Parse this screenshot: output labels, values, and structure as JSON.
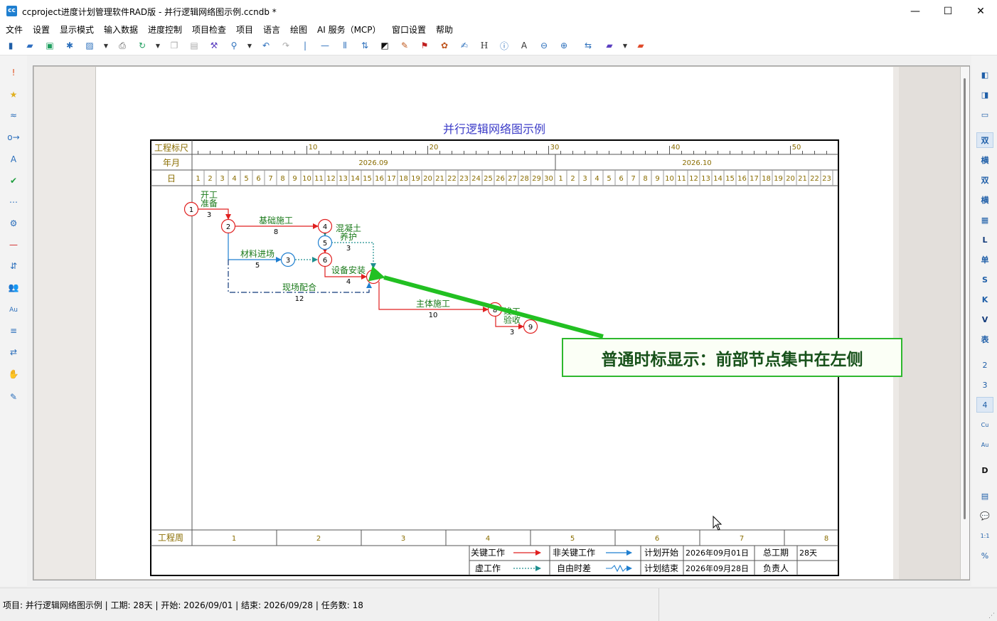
{
  "window": {
    "title": "ccproject进度计划管理软件RAD版 - 并行逻辑网络图示例.ccndb *",
    "minimize": "—",
    "maximize": "☐",
    "close": "✕"
  },
  "menu": [
    "文件",
    "设置",
    "显示模式",
    "输入数据",
    "进度控制",
    "项目检查",
    "项目",
    "语言",
    "绘图",
    "AI 服务（MCP）",
    "窗口设置",
    "帮助"
  ],
  "toolbar_icons": [
    "new",
    "open",
    "save",
    "asterisk",
    "image",
    "dropdown",
    "print",
    "refresh",
    "dropdown",
    "copy",
    "paste",
    "brush",
    "search",
    "dropdown",
    "undo",
    "redo",
    "vline",
    "hline",
    "bars",
    "sort",
    "blackbox",
    "paint",
    "flag",
    "palette",
    "edit",
    "H",
    "info",
    "A",
    "zoom-out",
    "zoom-in",
    "swap",
    "folder",
    "dropdown",
    "red-folder"
  ],
  "left_tools": [
    "!",
    "★",
    "≈",
    "o→",
    "A",
    "✔",
    "⋯",
    "⚙",
    "—",
    "⇵",
    "👥",
    "Au",
    "≡",
    "⇄",
    "✋",
    "✎"
  ],
  "right_tools": [
    "◧",
    "◨",
    "▭",
    "双",
    "横",
    "双",
    "横",
    "▦",
    "L",
    "单",
    "S",
    "K",
    "V",
    "表",
    "2",
    "3",
    "4",
    "Cu",
    "Au",
    "D",
    "▤",
    "💬",
    "1:1",
    "%"
  ],
  "diagram": {
    "title": "并行逻辑网络图示例",
    "header_labels": {
      "ruler": "工程标尺",
      "month": "年月",
      "day": "日",
      "week": "工程周"
    },
    "ruler_ticks": [
      "10",
      "20",
      "30",
      "40",
      "50"
    ],
    "months": [
      "2026.09",
      "2026.10"
    ],
    "days": [
      "1",
      "2",
      "3",
      "4",
      "5",
      "6",
      "7",
      "8",
      "9",
      "10",
      "11",
      "12",
      "13",
      "14",
      "15",
      "16",
      "17",
      "18",
      "19",
      "20",
      "21",
      "22",
      "23",
      "24",
      "25",
      "26",
      "27",
      "28",
      "29",
      "30",
      "1",
      "2",
      "3",
      "4",
      "5",
      "6",
      "7",
      "8",
      "9",
      "10",
      "11",
      "12",
      "13",
      "14",
      "15",
      "16",
      "17",
      "18",
      "19",
      "20",
      "21",
      "22",
      "23"
    ],
    "weeks": [
      "1",
      "2",
      "3",
      "4",
      "5",
      "6",
      "7",
      "8"
    ],
    "tasks": [
      {
        "name": "开工\n准备",
        "duration": "3",
        "type": "critical"
      },
      {
        "name": "基础施工",
        "duration": "8",
        "type": "critical"
      },
      {
        "name": "材料进场",
        "duration": "5",
        "type": "normal"
      },
      {
        "name": "混凝土\n养护",
        "duration": "3",
        "type": "dummy"
      },
      {
        "name": "设备安装",
        "duration": "4",
        "type": "critical"
      },
      {
        "name": "现场配合",
        "duration": "12",
        "type": "dummy"
      },
      {
        "name": "主体施工",
        "duration": "10",
        "type": "critical"
      },
      {
        "name": "竣工\n验收",
        "duration": "3",
        "type": "critical"
      }
    ],
    "nodes": [
      "1",
      "2",
      "3",
      "4",
      "5",
      "6",
      "7",
      "8",
      "9"
    ],
    "legend": {
      "critical": "关键工作",
      "noncritical": "非关键工作",
      "dummy": "虚工作",
      "float": "自由时差",
      "plan_start_label": "计划开始",
      "plan_start": "2026年09月01日",
      "plan_end_label": "计划结束",
      "plan_end": "2026年09月28日",
      "total_label": "总工期",
      "total": "28天",
      "owner_label": "负责人",
      "owner": ""
    }
  },
  "callout": "普通时标显示：前部节点集中在左侧",
  "status": "项目: 并行逻辑网络图示例 | 工期: 28天 | 开始: 2026/09/01 | 结束: 2026/09/28 | 任务数: 18",
  "colors": {
    "critical": "#e02020",
    "noncritical": "#1f7fd0",
    "dummy": "#1f8f8f",
    "title": "#3c3cc8",
    "callout_green": "#22c022",
    "header_text": "#8a6d00"
  }
}
